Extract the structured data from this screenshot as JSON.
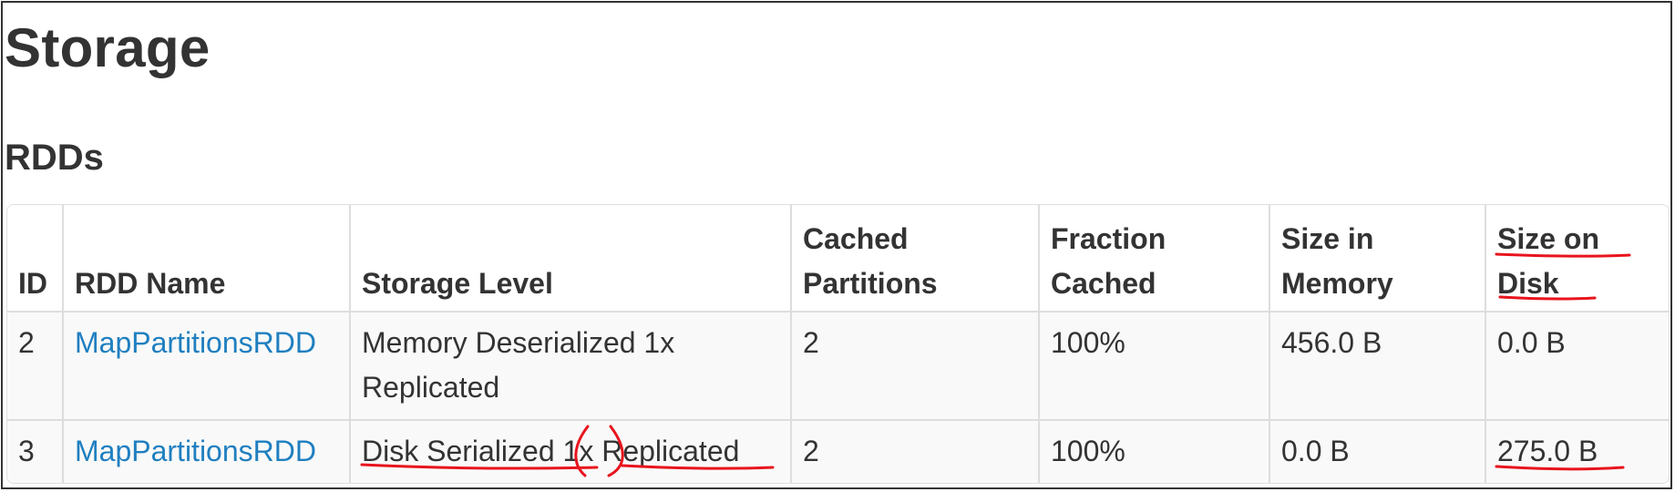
{
  "page": {
    "title": "Storage",
    "section": "RDDs"
  },
  "table": {
    "headers": {
      "id": "ID",
      "rdd_name": "RDD Name",
      "storage_level": "Storage Level",
      "cached_partitions_1": "Cached",
      "cached_partitions_2": "Partitions",
      "fraction_cached_1": "Fraction",
      "fraction_cached_2": "Cached",
      "size_in_memory_1": "Size in",
      "size_in_memory_2": "Memory",
      "size_on_disk_1": "Size on",
      "size_on_disk_2": "Disk"
    },
    "rows": [
      {
        "id": "2",
        "rdd_name": "MapPartitionsRDD",
        "storage_level_1": "Memory Deserialized 1x",
        "storage_level_2": "Replicated",
        "cached_partitions": "2",
        "fraction_cached": "100%",
        "size_in_memory": "456.0 B",
        "size_on_disk": "0.0 B"
      },
      {
        "id": "3",
        "rdd_name": "MapPartitionsRDD",
        "storage_level": "Disk Serialized 1x Replicated",
        "cached_partitions": "2",
        "fraction_cached": "100%",
        "size_in_memory": "0.0 B",
        "size_on_disk": "275.0 B"
      }
    ]
  },
  "colors": {
    "link": "#1f7fc0",
    "text": "#333333",
    "annotation": "#e8141d",
    "border": "#dddddd",
    "stripe": "#f9f9f9"
  }
}
